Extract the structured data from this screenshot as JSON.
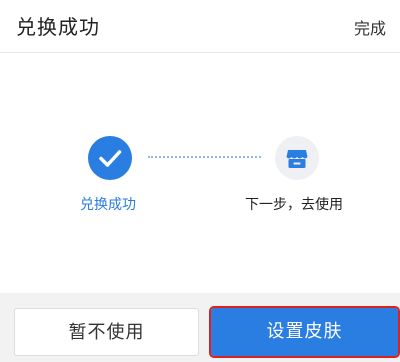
{
  "header": {
    "title": "兑换成功",
    "done_label": "完成"
  },
  "steps": [
    {
      "label": "兑换成功",
      "icon": "checkmark-icon",
      "status": "done"
    },
    {
      "label": "下一步，去使用",
      "icon": "shop-icon",
      "status": "next"
    }
  ],
  "footer": {
    "secondary_label": "暂不使用",
    "primary_label": "设置皮肤"
  },
  "colors": {
    "accent": "#2a7de1",
    "highlight": "#e02020"
  }
}
